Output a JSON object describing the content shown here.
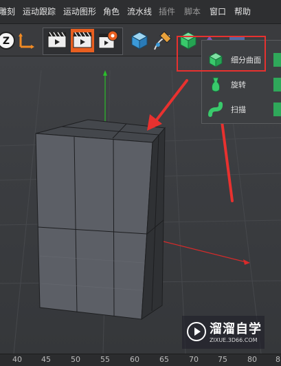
{
  "menu": {
    "items": [
      "雕刻",
      "运动跟踪",
      "运动图形",
      "角色",
      "流水线",
      "插件",
      "脚本",
      "窗口",
      "帮助"
    ]
  },
  "toolbar": {
    "icons": [
      "undo-z-icon",
      "coordinate-axis-icon",
      "render-view-icon",
      "render-picture-icon",
      "render-settings-icon",
      "cube-icon",
      "pen-spline-icon",
      "subdivision-surface-icon"
    ]
  },
  "popup": {
    "items": [
      {
        "label": "细分曲面",
        "icon": "subdivision-surface-icon"
      },
      {
        "label": "旋转",
        "icon": "lathe-icon"
      },
      {
        "label": "扫描",
        "icon": "sweep-icon"
      }
    ]
  },
  "ruler": {
    "ticks": [
      "40",
      "45",
      "50",
      "55",
      "60",
      "65",
      "70",
      "75",
      "80",
      "8"
    ]
  },
  "watermark": {
    "title": "溜溜自学",
    "subtitle": "ZIXUE.3D66.COM"
  },
  "colors": {
    "highlight": "#e8312f",
    "accent_green": "#39c96b",
    "menu_bg": "#2e2f31",
    "viewport_bg": "#3b3d40"
  }
}
